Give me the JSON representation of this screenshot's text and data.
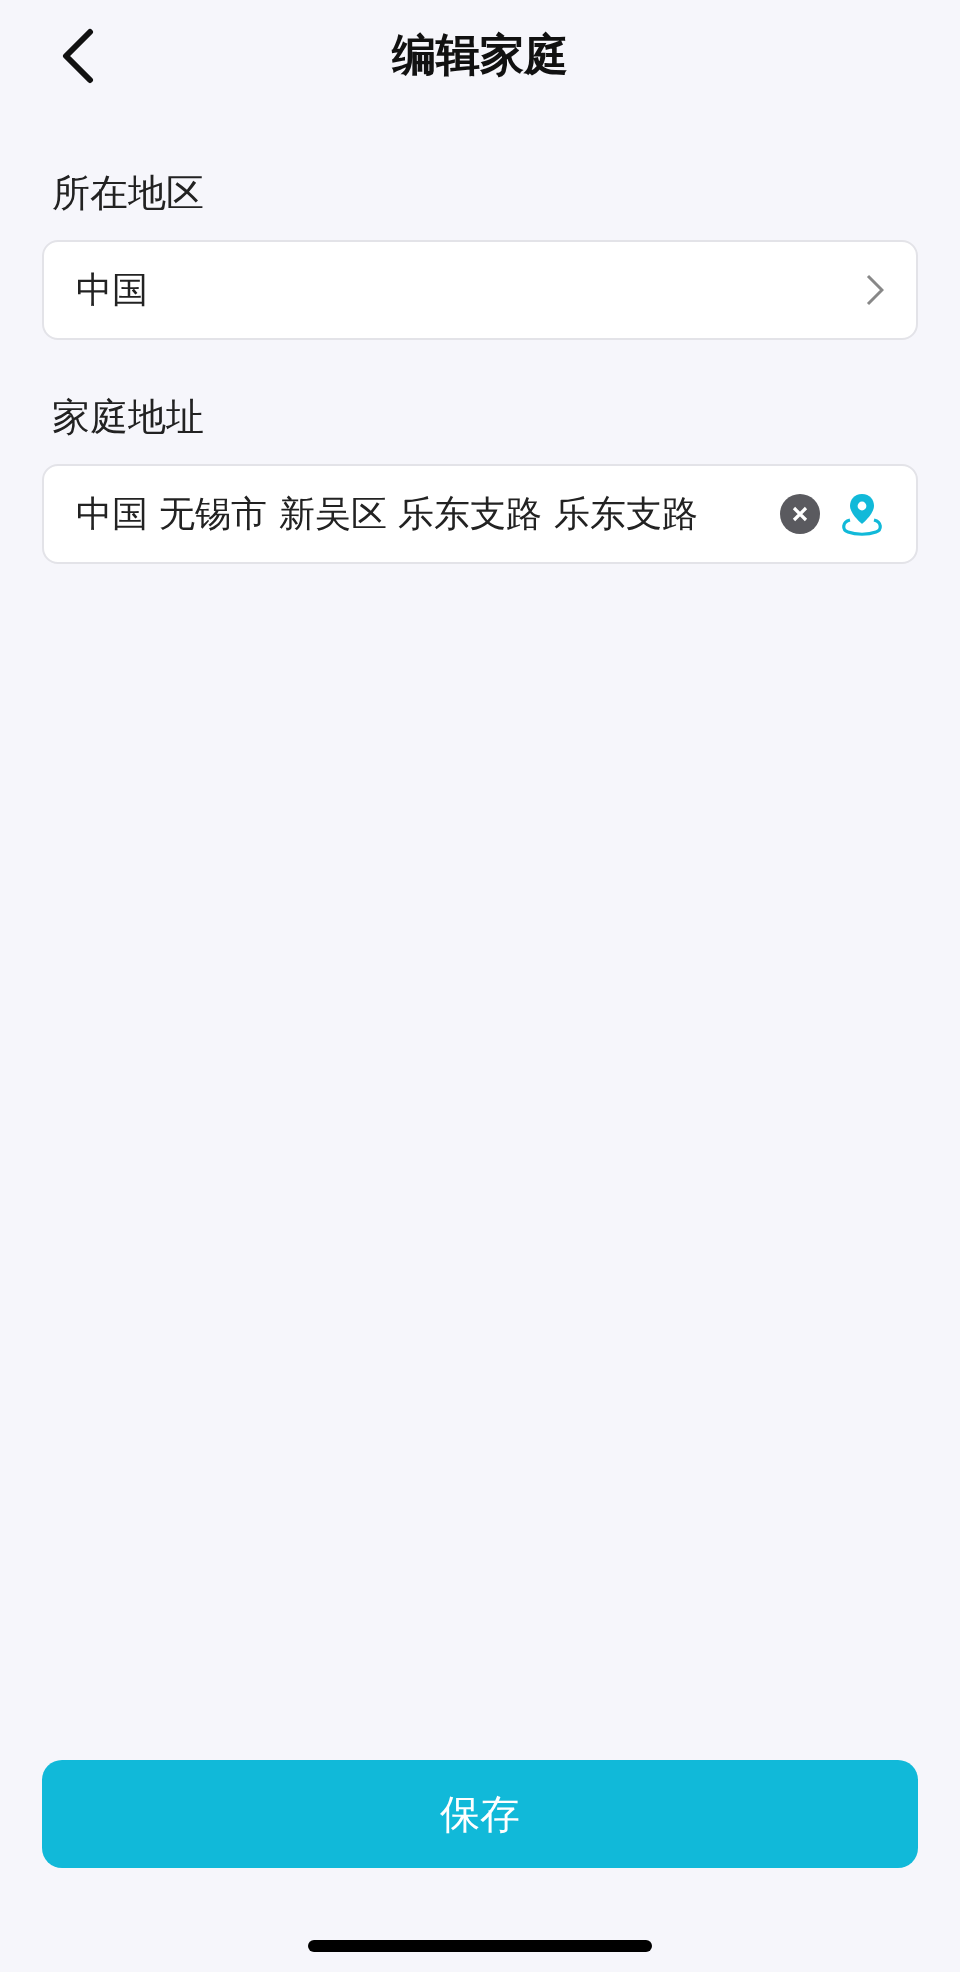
{
  "header": {
    "title": "编辑家庭"
  },
  "region": {
    "label": "所在地区",
    "value": "中国"
  },
  "address": {
    "label": "家庭地址",
    "value": "中国 无锡市 新吴区 乐东支路 乐东支路"
  },
  "save_button": "保存"
}
